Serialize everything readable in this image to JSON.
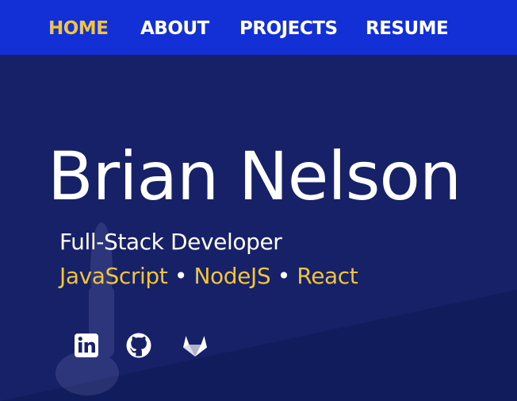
{
  "nav": {
    "items": [
      {
        "label": "HOME",
        "active": true
      },
      {
        "label": "ABOUT",
        "active": false
      },
      {
        "label": "PROJECTS",
        "active": false
      },
      {
        "label": "RESUME",
        "active": false
      }
    ]
  },
  "hero": {
    "name": "Brian Nelson",
    "role": "Full-Stack Developer",
    "skills": [
      "JavaScript",
      "NodeJS",
      "React"
    ],
    "separator": "•"
  },
  "social": [
    {
      "icon": "linkedin-icon"
    },
    {
      "icon": "github-icon"
    },
    {
      "icon": "gitlab-icon"
    }
  ],
  "colors": {
    "background": "#172167",
    "navbar": "#1230d6",
    "accent": "#f0c43b",
    "text": "#ffffff"
  }
}
